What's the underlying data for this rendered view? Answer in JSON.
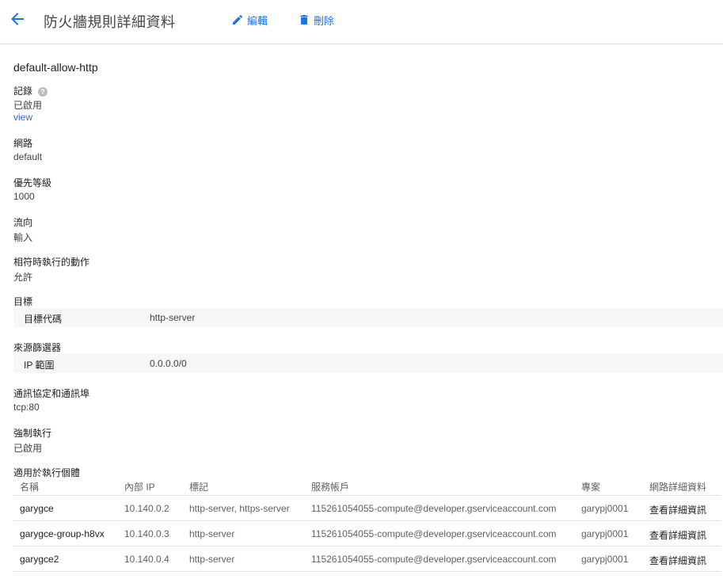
{
  "header": {
    "title": "防火牆規則詳細資料",
    "edit_label": "編輯",
    "delete_label": "刪除"
  },
  "rule": {
    "name": "default-allow-http",
    "logs": {
      "label": "記錄",
      "value": "已啟用",
      "link": "view"
    },
    "network": {
      "label": "網路",
      "value": "default"
    },
    "priority": {
      "label": "優先等級",
      "value": "1000"
    },
    "direction": {
      "label": "流向",
      "value": "輸入"
    },
    "action": {
      "label": "相符時執行的動作",
      "value": "允許"
    },
    "targets": {
      "label": "目標",
      "key": "目標代碼",
      "value": "http-server"
    },
    "source_filter": {
      "label": "來源篩選器",
      "key": "IP 範圍",
      "value": "0.0.0.0/0"
    },
    "protocols": {
      "label": "通訊協定和通訊埠",
      "value": "tcp:80"
    },
    "enforcement": {
      "label": "強制執行",
      "value": "已啟用"
    },
    "applies_to": {
      "label": "適用於執行個體"
    }
  },
  "instances_table": {
    "headers": [
      "名稱",
      "內部 IP",
      "標記",
      "服務帳戶",
      "專案",
      "網路詳細資料"
    ],
    "rows": [
      {
        "name": "garygce",
        "ip": "10.140.0.2",
        "tags": "http-server, https-server",
        "service_account": "115261054055-compute@developer.gserviceaccount.com",
        "project": "garypj0001",
        "details": "查看詳細資訊"
      },
      {
        "name": "garygce-group-h8vx",
        "ip": "10.140.0.3",
        "tags": "http-server",
        "service_account": "115261054055-compute@developer.gserviceaccount.com",
        "project": "garypj0001",
        "details": "查看詳細資訊"
      },
      {
        "name": "garygce2",
        "ip": "10.140.0.4",
        "tags": "http-server",
        "service_account": "115261054055-compute@developer.gserviceaccount.com",
        "project": "garypj0001",
        "details": "查看詳細資訊"
      }
    ]
  },
  "colors": {
    "accent": "#1a73e8",
    "link": "#3367d6",
    "divider": "#dcdcdc",
    "kv_background": "#f7f7f7"
  },
  "icons": {
    "back": "arrow-left-icon",
    "edit": "pencil-icon",
    "delete": "trash-icon",
    "help": "help-icon"
  }
}
